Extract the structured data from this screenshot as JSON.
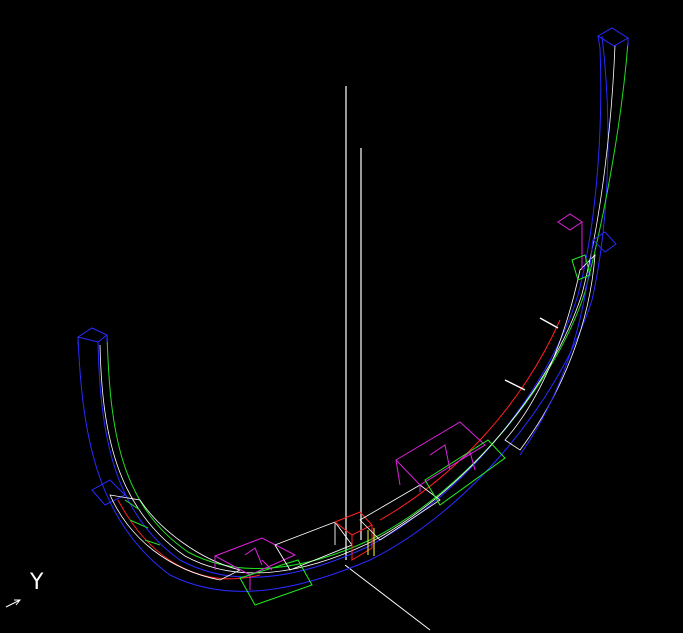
{
  "view": {
    "background": "#000000",
    "axis_label_y": "Y"
  },
  "colors": {
    "outer_edge": "#2a2aff",
    "inner_edge": "#22dd22",
    "center_line": "#ffffff",
    "red_line": "#ff2020",
    "support_top": "#dd22dd",
    "support_bottom": "#22ee22",
    "axis": "#ffffff",
    "joint_yellow": "#ffff33"
  }
}
